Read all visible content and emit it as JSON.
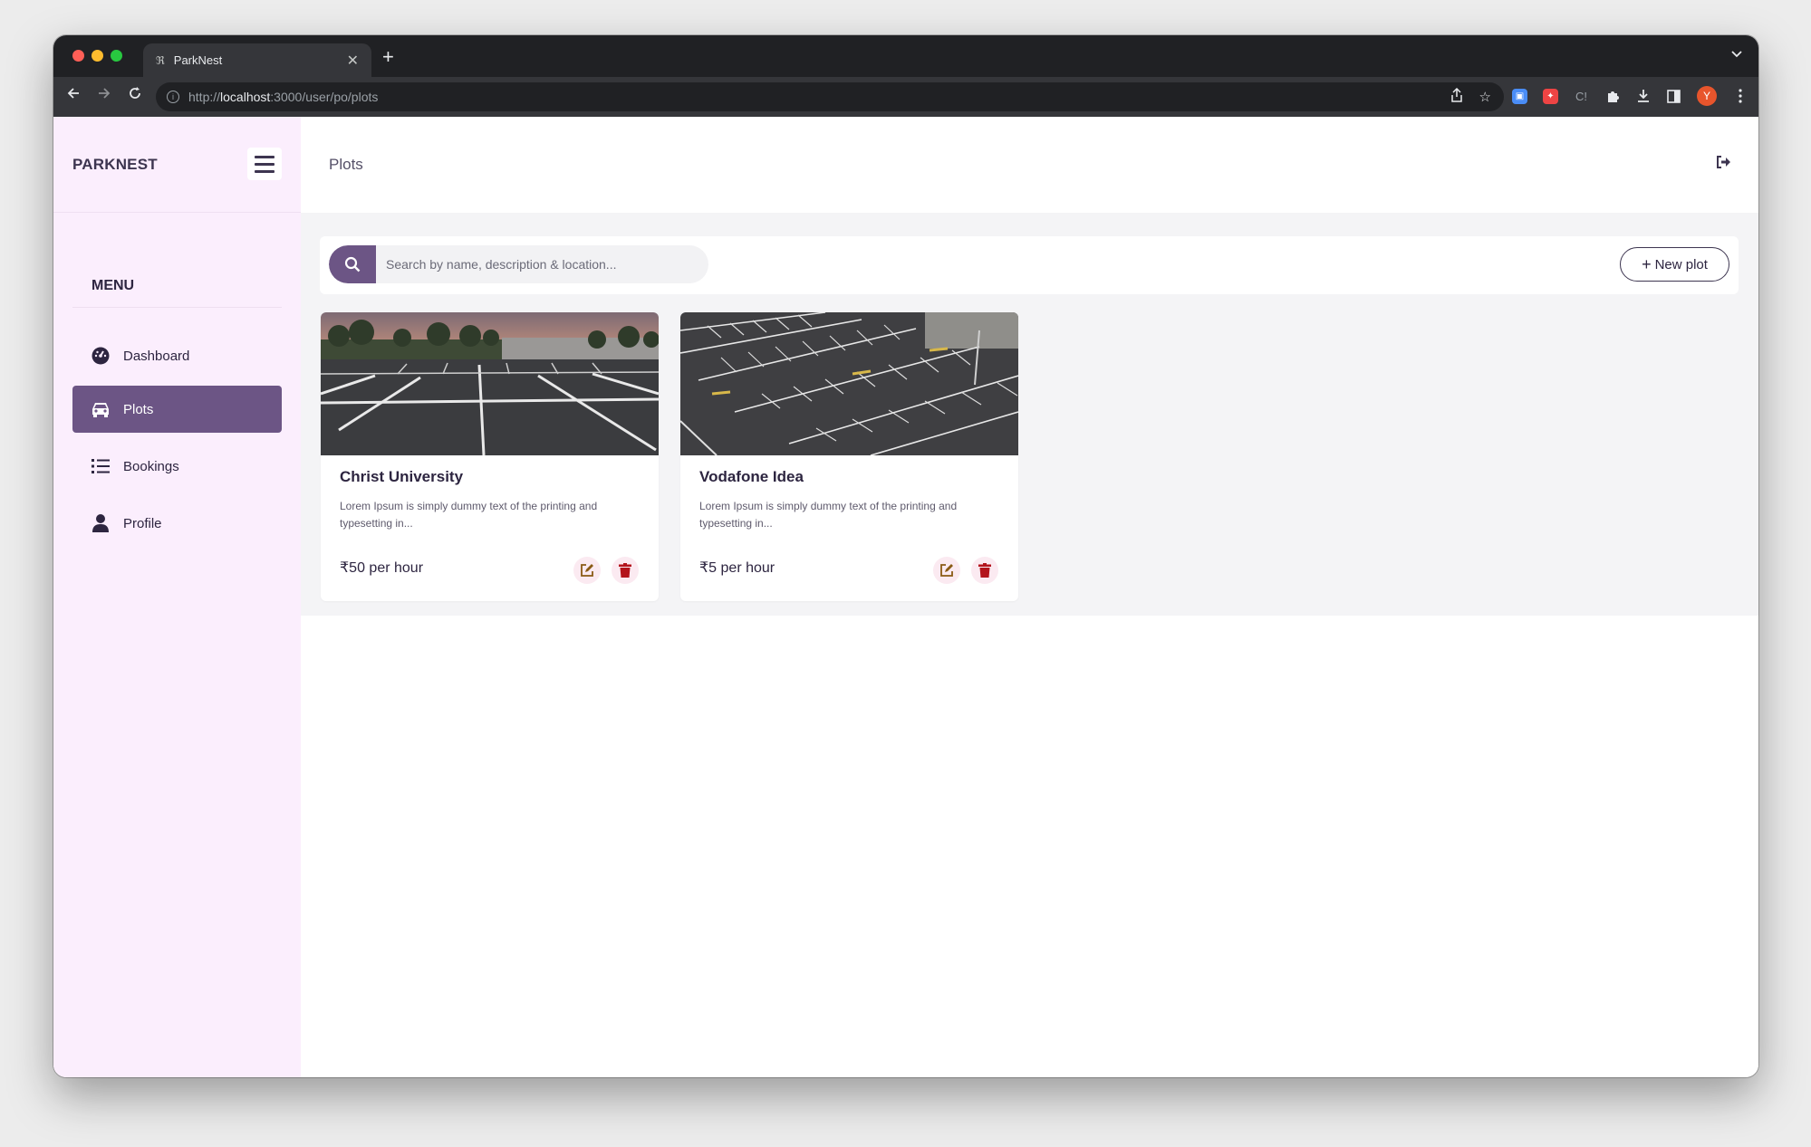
{
  "browser": {
    "tab_title": "ParkNest",
    "tab_favicon": "ℜ",
    "url_scheme": "http://",
    "url_host": "localhost",
    "url_path": ":3000/user/po/plots",
    "profile_initial": "Y"
  },
  "sidebar": {
    "brand": "PARKNEST",
    "menu_heading": "MENU",
    "items": [
      {
        "label": "Dashboard",
        "icon": "dashboard-gauge-icon"
      },
      {
        "label": "Plots",
        "icon": "car-icon",
        "active": true
      },
      {
        "label": "Bookings",
        "icon": "list-icon"
      },
      {
        "label": "Profile",
        "icon": "user-icon"
      }
    ]
  },
  "header": {
    "page_title": "Plots"
  },
  "search": {
    "placeholder": "Search by name, description & location...",
    "value": ""
  },
  "actions": {
    "new_plot_label": "New plot",
    "new_plot_prefix": "+"
  },
  "plots": [
    {
      "name": "Christ University",
      "description": "Lorem Ipsum is simply dummy text of the printing and typesetting in...",
      "price": "₹50 per hour"
    },
    {
      "name": "Vodafone Idea",
      "description": "Lorem Ipsum is simply dummy text of the printing and typesetting in...",
      "price": "₹5 per hour"
    }
  ],
  "colors": {
    "accent": "#6c5585",
    "sidebar_bg": "#fbeefd",
    "delete": "#b3141c",
    "edit": "#8a5a14"
  }
}
